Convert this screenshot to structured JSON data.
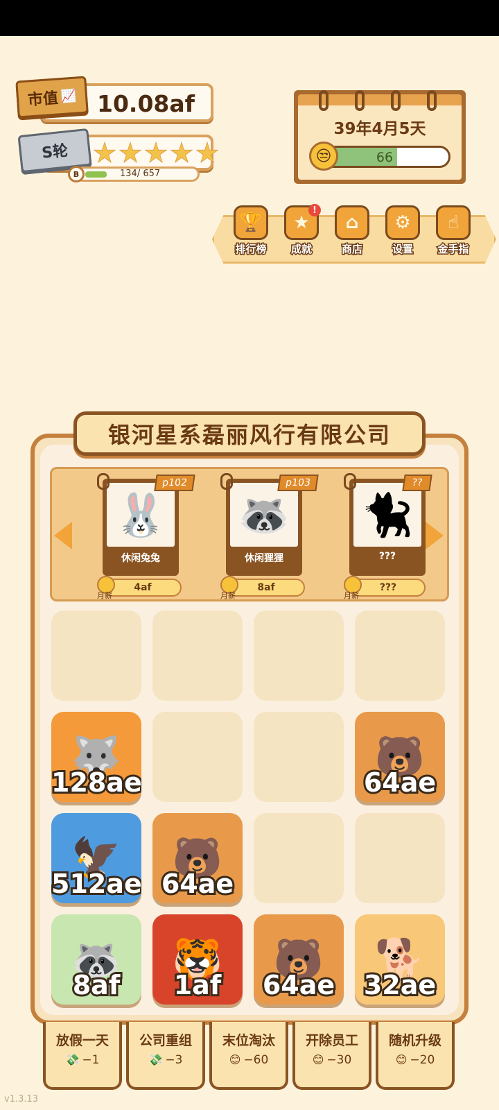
{
  "stats": {
    "market_value_label": "市值",
    "market_value": "10.08af",
    "round_label": "S轮",
    "stars_total": 5,
    "level_badge": "B",
    "exp_text": "134/ 657",
    "exp_fraction": 0.204
  },
  "calendar": {
    "date": "39年4月5天",
    "mood_value": "66",
    "mood_fraction": 0.6
  },
  "toolbar": {
    "items": [
      {
        "label": "排行榜",
        "icon": "trophy-icon",
        "glyph": "🏆"
      },
      {
        "label": "成就",
        "icon": "medal-icon",
        "glyph": "★",
        "alert": "!"
      },
      {
        "label": "商店",
        "icon": "shop-icon",
        "glyph": "⌂"
      },
      {
        "label": "设置",
        "icon": "gear-icon",
        "glyph": "⚙"
      },
      {
        "label": "金手指",
        "icon": "hand-pointer-icon",
        "glyph": "☝"
      }
    ]
  },
  "company": {
    "name": "银河星系磊丽风行有限公司"
  },
  "hire": {
    "salary_label": "月薪",
    "cards": [
      {
        "tag": "p102",
        "name": "休闲兔兔",
        "salary": "4af",
        "art": "🐰"
      },
      {
        "tag": "p103",
        "name": "休闲狸狸",
        "salary": "8af",
        "art": "🦝"
      },
      {
        "tag": "??",
        "name": "???",
        "salary": "???",
        "art": "🐈‍⬛"
      }
    ]
  },
  "grid": {
    "slots": [
      {
        "value": "",
        "art": "",
        "bg": ""
      },
      {
        "value": "",
        "art": "",
        "bg": ""
      },
      {
        "value": "",
        "art": "",
        "bg": ""
      },
      {
        "value": "",
        "art": "",
        "bg": ""
      },
      {
        "value": "128ae",
        "art": "🐺",
        "bg": "#f59a3a"
      },
      {
        "value": "",
        "art": "",
        "bg": ""
      },
      {
        "value": "",
        "art": "",
        "bg": ""
      },
      {
        "value": "64ae",
        "art": "🐻",
        "bg": "#e89a4a"
      },
      {
        "value": "512ae",
        "art": "🦅",
        "bg": "#4f9be0"
      },
      {
        "value": "64ae",
        "art": "🐻",
        "bg": "#e89a4a"
      },
      {
        "value": "",
        "art": "",
        "bg": ""
      },
      {
        "value": "",
        "art": "",
        "bg": ""
      },
      {
        "value": "8af",
        "art": "🦝",
        "bg": "#c8e6b0"
      },
      {
        "value": "1af",
        "art": "🐯",
        "bg": "#d8442a"
      },
      {
        "value": "64ae",
        "art": "🐻",
        "bg": "#e89a4a"
      },
      {
        "value": "32ae",
        "art": "🐕",
        "bg": "#f8c878"
      }
    ]
  },
  "actions": [
    {
      "label": "放假一天",
      "cost": "−1",
      "icon": "cash-icon",
      "glyph": "💸"
    },
    {
      "label": "公司重组",
      "cost": "−3",
      "icon": "cash-icon",
      "glyph": "💸"
    },
    {
      "label": "末位淘汰",
      "cost": "−60",
      "icon": "smile-icon",
      "glyph": "😊"
    },
    {
      "label": "开除员工",
      "cost": "−30",
      "icon": "smile-icon",
      "glyph": "😊"
    },
    {
      "label": "随机升级",
      "cost": "−20",
      "icon": "smile-icon",
      "glyph": "😊"
    }
  ],
  "version": "v1.3.13"
}
